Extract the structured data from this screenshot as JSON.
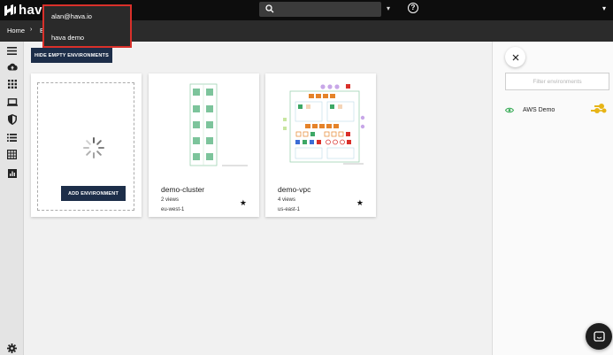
{
  "app": {
    "logo_text": "hava"
  },
  "dropdown": {
    "items": [
      "alan@hava.io",
      "hava demo"
    ]
  },
  "breadcrumb": {
    "home": "Home",
    "separator": "›",
    "current": "E"
  },
  "toolbar": {
    "hide_empty_label": "HIDE EMPTY ENVIRONMENTS"
  },
  "add_card": {
    "button_label": "ADD ENVIRONMENT"
  },
  "environments": [
    {
      "name": "demo-cluster",
      "views": "2 views",
      "region": "eu-west-1"
    },
    {
      "name": "demo-vpc",
      "views": "4 views",
      "region": "us-east-1"
    }
  ],
  "filter": {
    "placeholder": "Filter environments"
  },
  "sources": [
    {
      "label": "AWS Demo"
    }
  ],
  "sidebar": {
    "icons": [
      "menu-icon",
      "cloud-upload-icon",
      "grid-icon",
      "laptop-icon",
      "shield-icon",
      "list-icon",
      "table-icon",
      "bar-chart-icon",
      "settings-icon"
    ]
  },
  "colors": {
    "navy_button": "#1d2e49",
    "topbar": "#0d0d0d",
    "highlight_border": "#d9302a",
    "eye_green": "#2fa84f",
    "star_gold": "#e7b416"
  }
}
